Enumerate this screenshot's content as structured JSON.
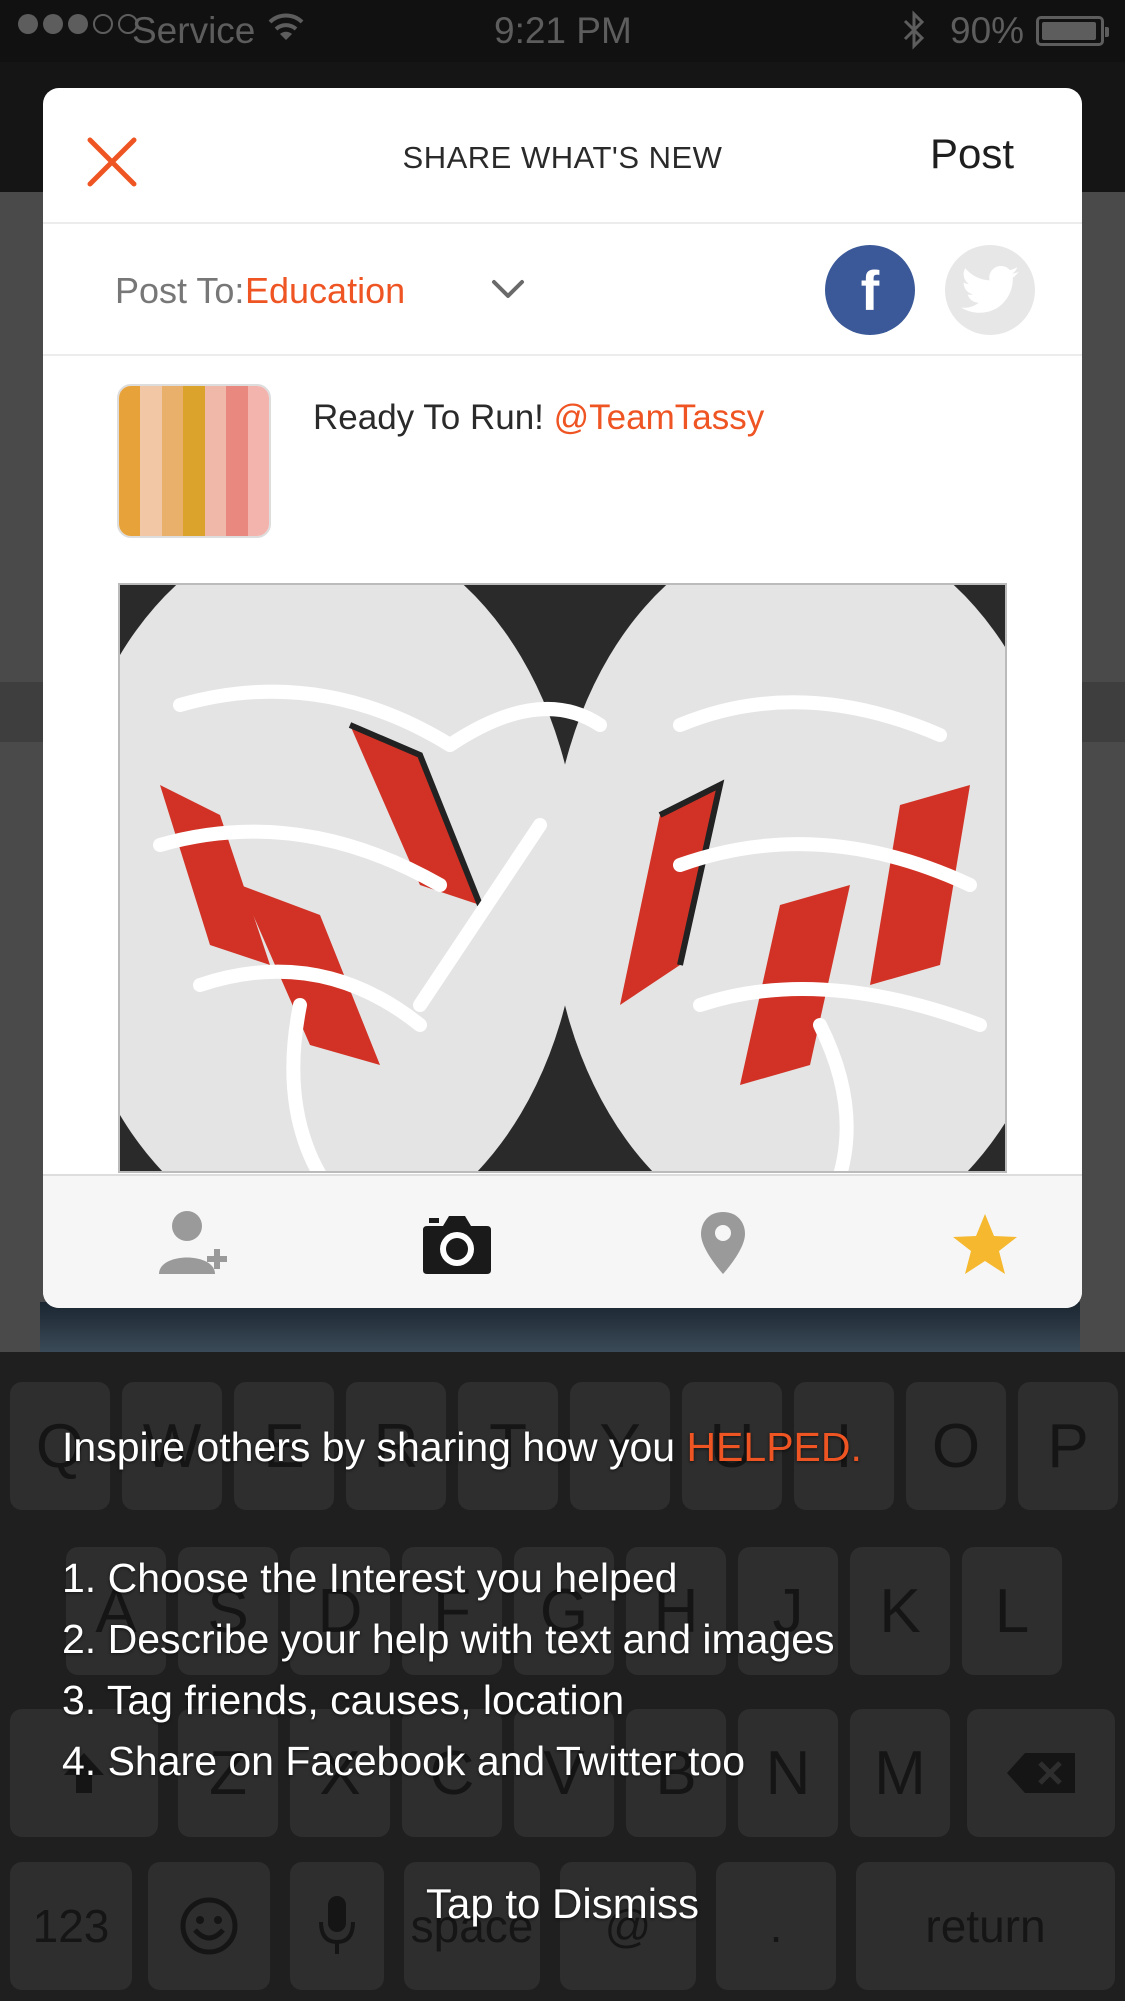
{
  "status_bar": {
    "carrier": "Service",
    "time": "9:21 PM",
    "battery": "90%",
    "battery_level": 0.9,
    "signal_icons": "signal-dots-icon"
  },
  "modal": {
    "title": "SHARE WHAT'S NEW",
    "post_label": "Post",
    "post_to_label": "Post To:",
    "post_to_value": "Education",
    "facebook_label": "f",
    "post_text": "Ready To Run! ",
    "mention": "@TeamTassy"
  },
  "toolbar": {
    "icons": [
      "add-person-icon",
      "camera-icon",
      "location-pin-icon",
      "star-icon"
    ]
  },
  "keyboard": {
    "row1": [
      "Q",
      "W",
      "E",
      "R",
      "T",
      "Y",
      "U",
      "I",
      "O",
      "P"
    ],
    "row2": [
      "A",
      "S",
      "D",
      "F",
      "G",
      "H",
      "J",
      "K",
      "L"
    ],
    "row3": [
      "Z",
      "X",
      "C",
      "V",
      "B",
      "N",
      "M"
    ],
    "numbers": "123",
    "space": "space",
    "at": "@",
    "period": ".",
    "return": "return"
  },
  "tip": {
    "title_prefix": "Inspire others by sharing how you ",
    "title_highlight": "HELPED.",
    "steps": [
      "1. Choose the Interest you helped",
      "2. Describe your help with text and images",
      "3. Tag friends, causes, location",
      "4. Share on Facebook and Twitter too"
    ],
    "dismiss": "Tap to Dismiss"
  },
  "colors": {
    "accent": "#ef5423",
    "facebook": "#3b5998",
    "star": "#f5b82e"
  }
}
